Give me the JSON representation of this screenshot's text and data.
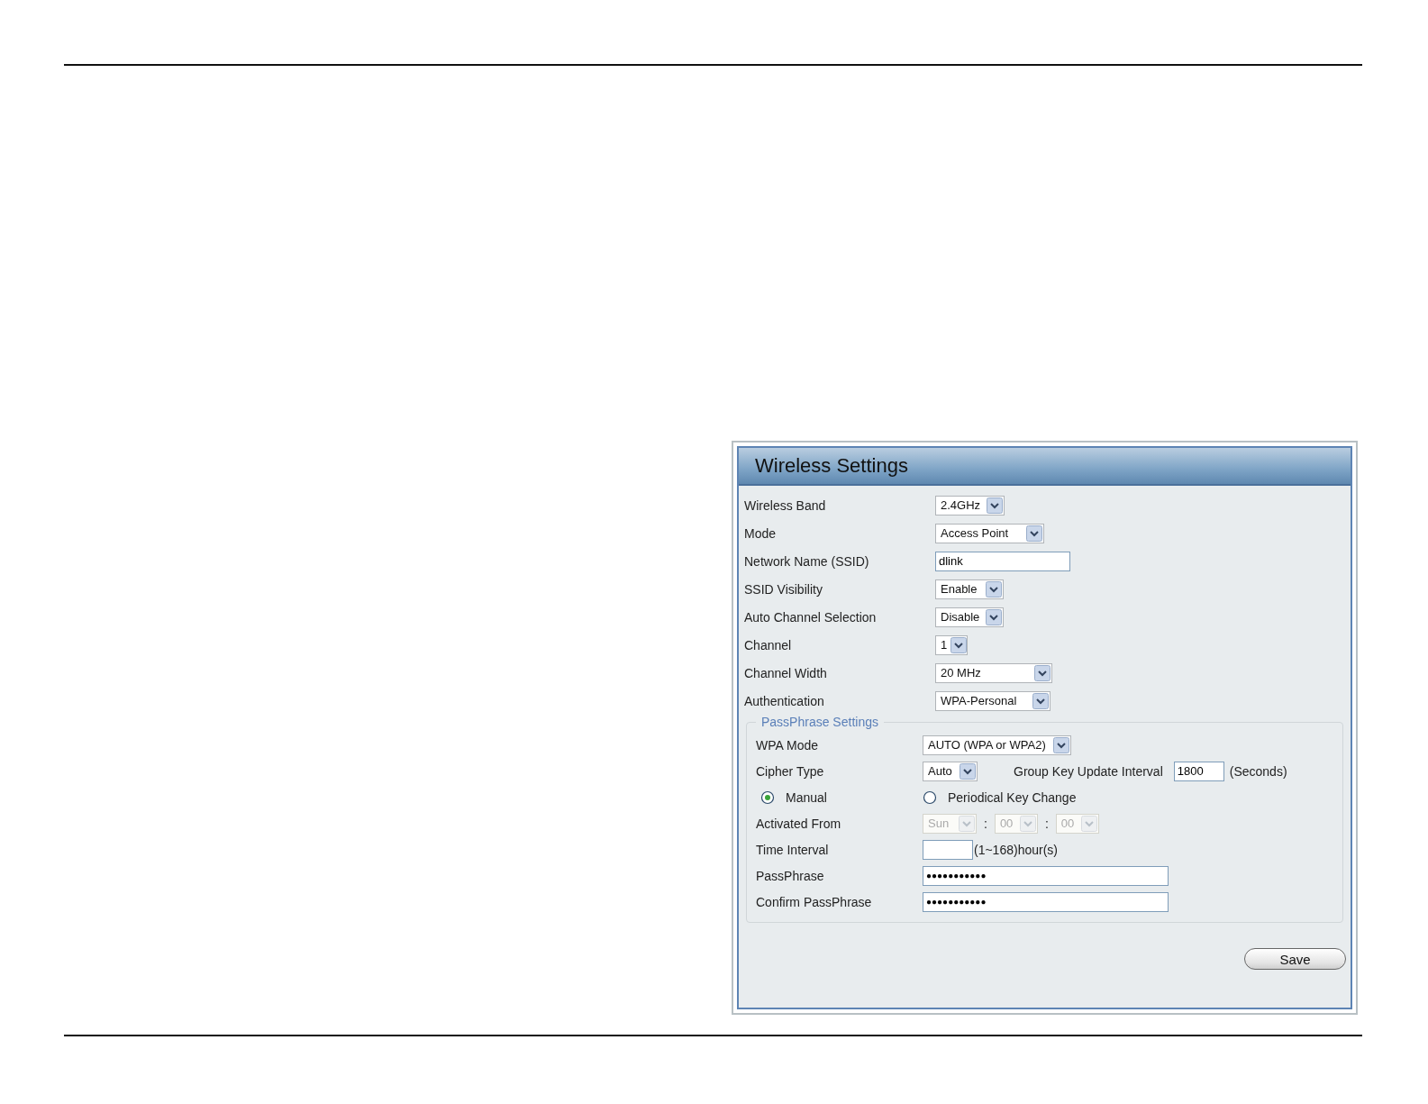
{
  "panel": {
    "title": "Wireless Settings",
    "rows": [
      {
        "label": "Wireless Band",
        "kind": "select",
        "value": "2.4GHz"
      },
      {
        "label": "Mode",
        "kind": "select",
        "value": "Access Point"
      },
      {
        "label": "Network Name (SSID)",
        "kind": "text",
        "value": "dlink"
      },
      {
        "label": "SSID Visibility",
        "kind": "select",
        "value": "Enable"
      },
      {
        "label": "Auto Channel Selection",
        "kind": "select",
        "value": "Disable"
      },
      {
        "label": "Channel",
        "kind": "select",
        "value": "1"
      },
      {
        "label": "Channel Width",
        "kind": "select",
        "value": "20 MHz"
      },
      {
        "label": "Authentication",
        "kind": "select",
        "value": "WPA-Personal"
      }
    ],
    "passphrase_settings": {
      "legend": "PassPhrase Settings",
      "wpa_mode": {
        "label": "WPA Mode",
        "value": "AUTO (WPA or WPA2)"
      },
      "cipher_type": {
        "label": "Cipher Type",
        "value": "Auto"
      },
      "group_key": {
        "label": "Group Key Update Interval",
        "value": "1800",
        "unit": "(Seconds)"
      },
      "key_options": [
        {
          "label": "Manual",
          "selected": true
        },
        {
          "label": "Periodical Key Change",
          "selected": false
        }
      ],
      "activated_from": {
        "label": "Activated From",
        "disabled": true,
        "day": "Sun",
        "hour": "00",
        "minute": "00",
        "separators": [
          ":",
          ":"
        ]
      },
      "time_interval": {
        "label": "Time Interval",
        "unit": "(1~168)hour(s)"
      },
      "passphrase": {
        "label": "PassPhrase",
        "value": "●●●●●●●●●●●"
      },
      "confirm_passphrase": {
        "label": "Confirm PassPhrase",
        "value": "●●●●●●●●●●●"
      }
    },
    "save_button": "Save"
  }
}
